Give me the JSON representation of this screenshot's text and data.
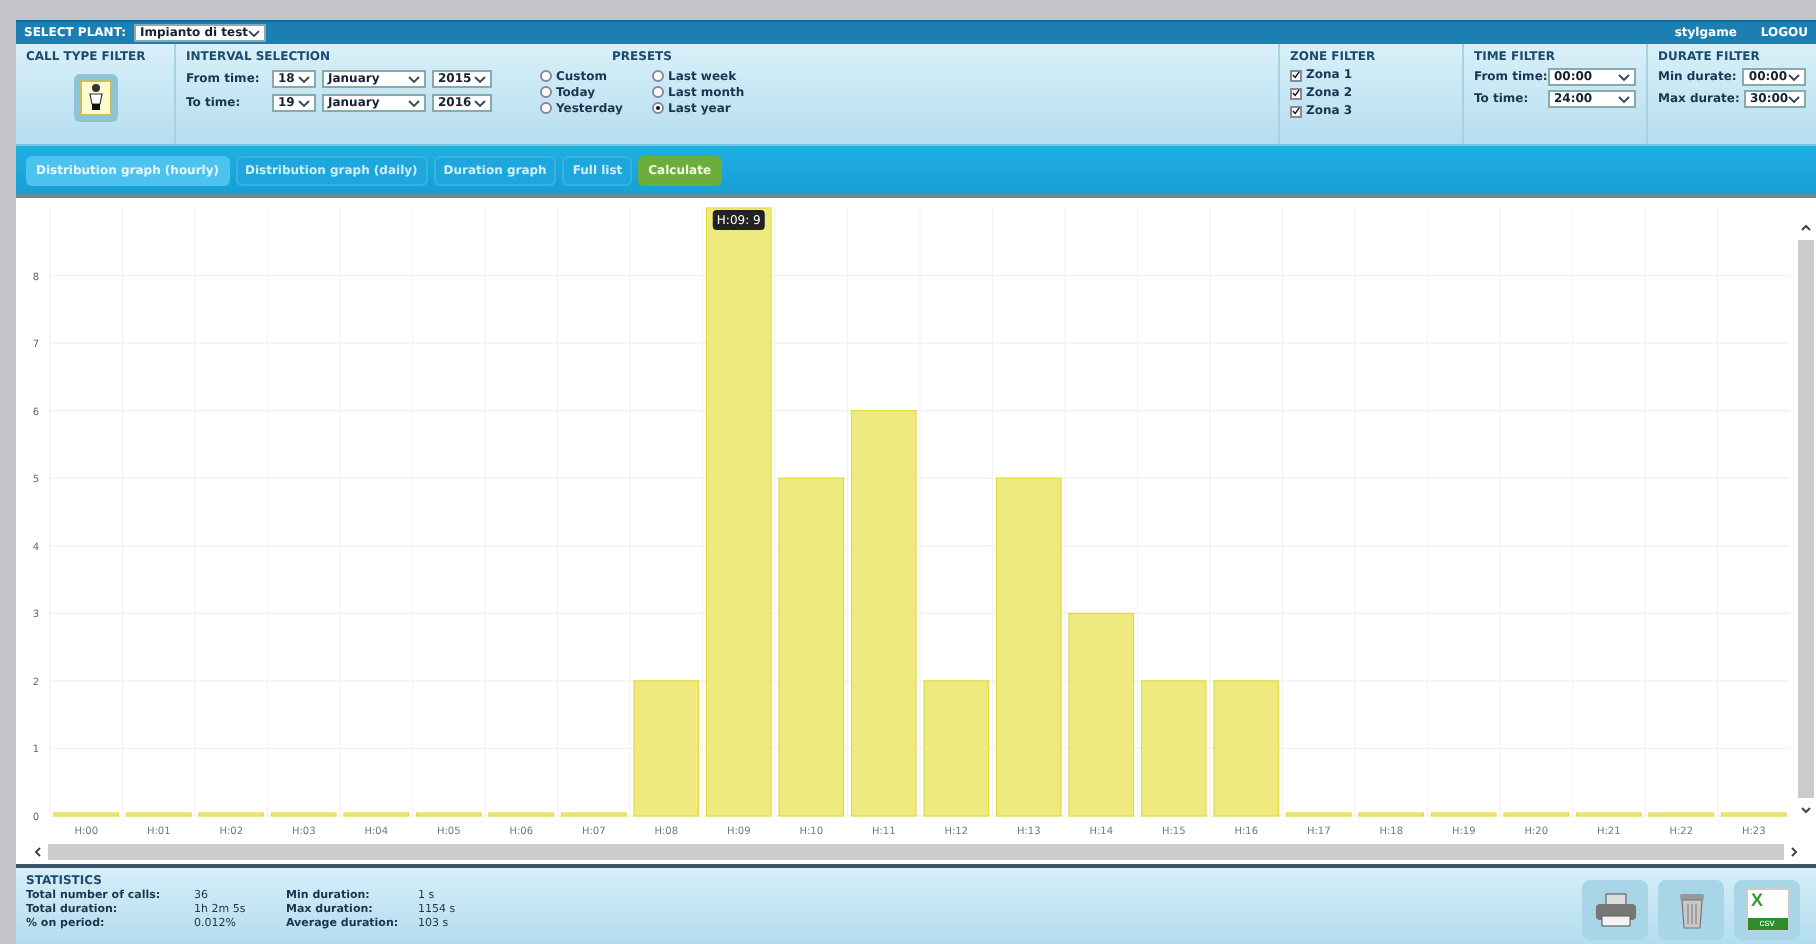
{
  "header": {
    "select_plant_label": "SELECT PLANT:",
    "plant": "Impianto di test",
    "user": "stylgame",
    "logout": "LOGOU"
  },
  "call_type_filter": {
    "title": "CALL TYPE FILTER"
  },
  "interval_selection": {
    "title": "INTERVAL SELECTION",
    "from_label": "From time:",
    "from": {
      "day": "18",
      "month": "January",
      "year": "2015"
    },
    "to_label": "To time:",
    "to": {
      "day": "19",
      "month": "January",
      "year": "2016"
    }
  },
  "presets": {
    "title": "PRESETS",
    "options": [
      {
        "label": "Custom",
        "selected": false
      },
      {
        "label": "Today",
        "selected": false
      },
      {
        "label": "Yesterday",
        "selected": false
      },
      {
        "label": "Last week",
        "selected": false
      },
      {
        "label": "Last month",
        "selected": false
      },
      {
        "label": "Last year",
        "selected": true
      }
    ]
  },
  "zone_filter": {
    "title": "ZONE FILTER",
    "zones": [
      {
        "label": "Zona 1",
        "checked": true
      },
      {
        "label": "Zona 2",
        "checked": true
      },
      {
        "label": "Zona 3",
        "checked": true
      }
    ]
  },
  "time_filter": {
    "title": "TIME FILTER",
    "from_label": "From time:",
    "from": "00:00",
    "to_label": "To time:",
    "to": "24:00"
  },
  "durate_filter": {
    "title": "DURATE FILTER",
    "min_label": "Min durate:",
    "min": "00:00",
    "max_label": "Max durate:",
    "max": "30:00"
  },
  "tabs": [
    {
      "label": "Distribution graph (hourly)",
      "kind": "tab",
      "selected": true
    },
    {
      "label": "Distribution graph (daily)",
      "kind": "tab",
      "selected": false
    },
    {
      "label": "Duration graph",
      "kind": "tab",
      "selected": false
    },
    {
      "label": "Full list",
      "kind": "tab",
      "selected": false
    },
    {
      "label": "Calculate",
      "kind": "action",
      "selected": false
    }
  ],
  "chart": {
    "tooltip": {
      "label": "H:09: 9"
    },
    "chart_data": {
      "type": "bar",
      "categories": [
        "H:00",
        "H:01",
        "H:02",
        "H:03",
        "H:04",
        "H:05",
        "H:06",
        "H:07",
        "H:08",
        "H:09",
        "H:10",
        "H:11",
        "H:12",
        "H:13",
        "H:14",
        "H:15",
        "H:16",
        "H:17",
        "H:18",
        "H:19",
        "H:20",
        "H:21",
        "H:22",
        "H:23"
      ],
      "grid": true,
      "series": [
        {
          "color": "#eeea80",
          "values": [
            0,
            0,
            0,
            0,
            0,
            0,
            0,
            0,
            2,
            9,
            5,
            6,
            2,
            5,
            3,
            2,
            2,
            0,
            0,
            0,
            0,
            0,
            0,
            0
          ]
        }
      ],
      "ylim": [
        0,
        9
      ],
      "yticks": [
        0,
        1,
        2,
        3,
        4,
        5,
        6,
        7,
        8
      ]
    }
  },
  "statistics": {
    "title": "STATISTICS",
    "items": [
      {
        "label": "Total number of calls:",
        "value": "36"
      },
      {
        "label": "Total duration:",
        "value": "1h 2m 5s"
      },
      {
        "label": "% on period:",
        "value": "0.012%"
      },
      {
        "label": "Min duration:",
        "value": "1 s"
      },
      {
        "label": "Max duration:",
        "value": "1154 s"
      },
      {
        "label": "Average duration:",
        "value": "103 s"
      }
    ]
  },
  "export": {
    "letter": "X",
    "caption": "csv"
  }
}
